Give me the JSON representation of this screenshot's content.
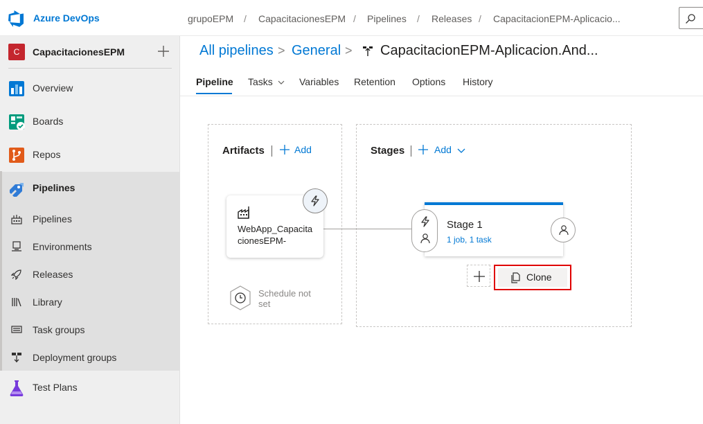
{
  "topbar": {
    "brand": "Azure DevOps",
    "breadcrumbs": [
      "grupoEPM",
      "CapacitacionesEPM",
      "Pipelines",
      "Releases",
      "CapacitacionEPM-Aplicacio..."
    ],
    "separator": "/"
  },
  "sidebar": {
    "project_initial": "C",
    "project_name": "CapacitacionesEPM",
    "items": [
      {
        "label": "Overview",
        "icon": "overview-icon"
      },
      {
        "label": "Boards",
        "icon": "boards-icon"
      },
      {
        "label": "Repos",
        "icon": "repos-icon"
      },
      {
        "label": "Pipelines",
        "icon": "pipelines-icon"
      }
    ],
    "sub_items": [
      {
        "label": "Pipelines",
        "icon": "pipelines-sub-icon"
      },
      {
        "label": "Environments",
        "icon": "environments-icon"
      },
      {
        "label": "Releases",
        "icon": "releases-icon"
      },
      {
        "label": "Library",
        "icon": "library-icon"
      },
      {
        "label": "Task groups",
        "icon": "task-groups-icon"
      },
      {
        "label": "Deployment groups",
        "icon": "deployment-groups-icon"
      }
    ],
    "test_plans": {
      "label": "Test Plans",
      "icon": "test-plans-icon"
    }
  },
  "header": {
    "all_pipelines": "All pipelines",
    "general": "General",
    "separator": ">",
    "current": "CapacitacionEPM-Aplicacion.And..."
  },
  "tabs": [
    {
      "label": "Pipeline",
      "active": true
    },
    {
      "label": "Tasks",
      "dropdown": true
    },
    {
      "label": "Variables"
    },
    {
      "label": "Retention"
    },
    {
      "label": "Options"
    },
    {
      "label": "History"
    }
  ],
  "artifacts": {
    "title": "Artifacts",
    "add_label": "Add",
    "artifact_name": "WebApp_CapacitacionesEPM-",
    "schedule_text": "Schedule not set"
  },
  "stages": {
    "title": "Stages",
    "add_label": "Add",
    "stage_name": "Stage 1",
    "stage_jobs": "1 job, 1 task",
    "clone_label": "Clone"
  },
  "colors": {
    "accent": "#0078d4",
    "project_badge": "#c4262e",
    "highlight_box": "#e00000"
  }
}
